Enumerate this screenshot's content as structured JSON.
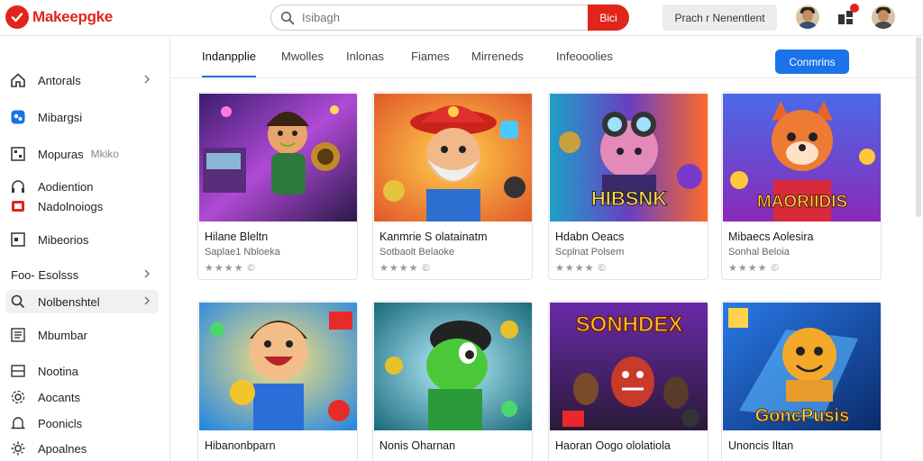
{
  "app": {
    "logo_text": "Makeepgke",
    "brand_color": "#e1251b",
    "accent_color": "#1a73e8"
  },
  "search": {
    "placeholder": "Isibagh",
    "button_label": "Bici"
  },
  "header": {
    "action_label": "Prach r Nenentlent"
  },
  "sidebar": {
    "items": [
      {
        "label": "Antorals",
        "icon": "home-icon"
      },
      {
        "label": "Mibargsi",
        "icon": "app-store-icon"
      },
      {
        "label": "Mopuras",
        "extra": "Mkiko",
        "icon": "gamepad-icon"
      },
      {
        "label": "Aodiention",
        "icon": "headphones-icon"
      },
      {
        "label": "Nadolnoiogs",
        "icon": "video-icon"
      },
      {
        "label": "Mibeorios",
        "icon": "screen-icon"
      },
      {
        "label": "Foo- Esolsss"
      },
      {
        "label": "Nolbenshtel",
        "icon": "search-icon"
      },
      {
        "label": "Mbumbar",
        "icon": "list-icon"
      },
      {
        "label": "Nootina",
        "icon": "inbox-icon"
      },
      {
        "label": "Aocants",
        "icon": "settings-icon"
      },
      {
        "label": "Poonicls",
        "icon": "bell-icon"
      },
      {
        "label": "Apoalnes",
        "icon": "gear-icon"
      }
    ]
  },
  "tabs": [
    {
      "label": "Indanpplie"
    },
    {
      "label": "Mwolles"
    },
    {
      "label": "Inlonas"
    },
    {
      "label": "Fiames"
    },
    {
      "label": "Mirreneds"
    },
    {
      "label": "Infeooolies"
    }
  ],
  "tab_cta": "Conmrins",
  "cards": [
    {
      "title": "Hilane Bleltn",
      "subtitle": "Saplae1 Nbloeka",
      "rating": "★★★★ ©",
      "thumb_text": ""
    },
    {
      "title": "Kanmrie S olatainatm",
      "subtitle": "Sotbaolt Belaoke",
      "rating": "★★★★ ©",
      "thumb_text": ""
    },
    {
      "title": "Hdabn Oeacs",
      "subtitle": "Scplnat Polsem",
      "rating": "★★★★ ©",
      "thumb_text": "HIBSNK"
    },
    {
      "title": "Mibaecs Aolesira",
      "subtitle": "Sonhal Beloia",
      "rating": "★★★★ ©",
      "thumb_text": "MAORIIDIS"
    },
    {
      "title": "Hibanonbparn",
      "subtitle": "",
      "rating": "",
      "thumb_text": ""
    },
    {
      "title": "Nonis Oharnan",
      "subtitle": "",
      "rating": "",
      "thumb_text": ""
    },
    {
      "title": "Haoran Oogo ololatiola",
      "subtitle": "",
      "rating": "",
      "thumb_text": "SONHDEX"
    },
    {
      "title": "Unoncis Iltan",
      "subtitle": "",
      "rating": "",
      "thumb_text": "GoncPusis"
    }
  ]
}
